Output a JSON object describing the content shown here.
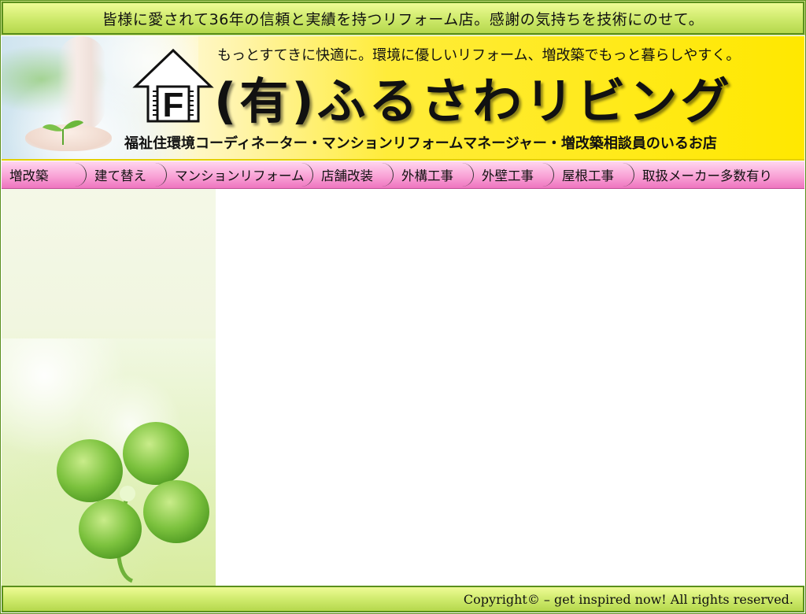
{
  "topbar": {
    "tagline": "皆様に愛されて36年の信頼と実績を持つリフォーム店。感謝の気持ちを技術にのせて。"
  },
  "header": {
    "subtitle": "もっとすてきに快適に。環境に優しいリフォーム、増改築でもっと暮らしやすく。",
    "brand": "(有)ふるさわリビング",
    "logo_text": "F",
    "credentials": "福祉住環境コーディネーター・マンションリフォームマネージャー・増改築相談員のいるお店"
  },
  "nav": {
    "items": [
      {
        "label": "増改築"
      },
      {
        "label": "建て替え"
      },
      {
        "label": "マンションリフォーム"
      },
      {
        "label": "店舗改装"
      },
      {
        "label": "外構工事"
      },
      {
        "label": "外壁工事"
      },
      {
        "label": "屋根工事"
      },
      {
        "label": "取扱メーカー多数有り"
      }
    ]
  },
  "footer": {
    "copyright": "Copyright© – get inspired now! All rights reserved."
  },
  "colors": {
    "bar_green": "#cde96a",
    "border_green": "#5a8f1c",
    "header_yellow": "#ffe800",
    "nav_pink": "#f9a3d6"
  }
}
